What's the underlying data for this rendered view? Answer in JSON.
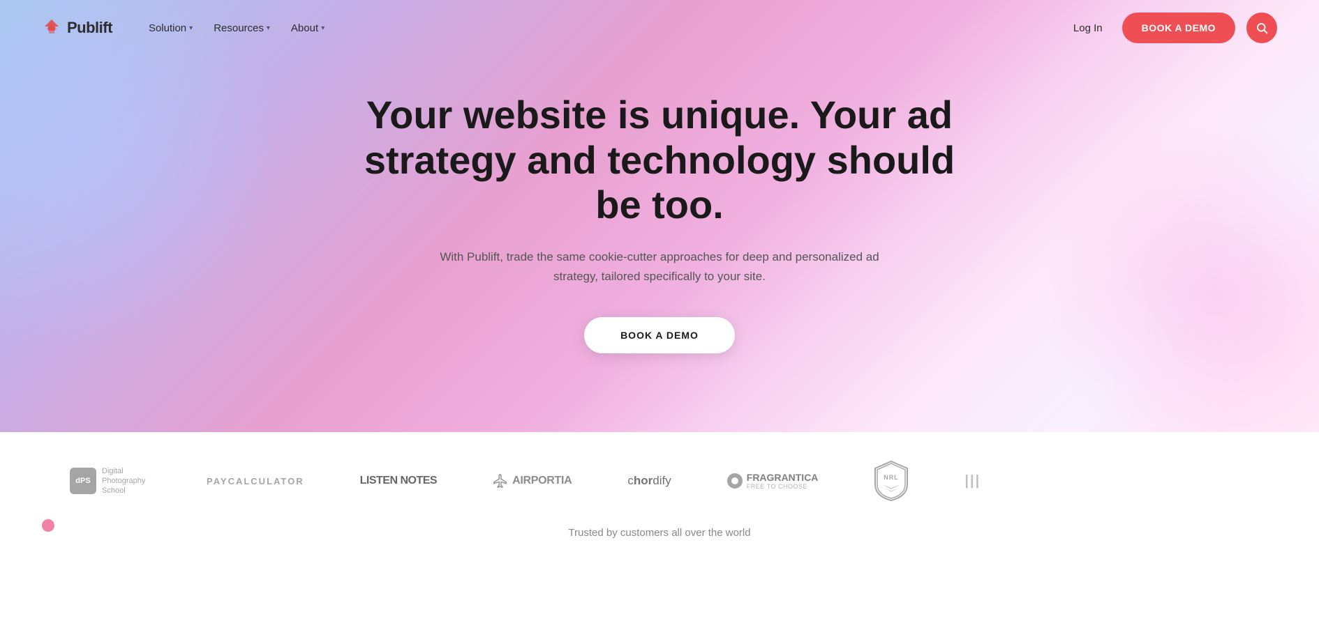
{
  "brand": {
    "name": "Publift",
    "logo_icon": "chevrons-up"
  },
  "nav": {
    "links": [
      {
        "label": "Solution",
        "has_dropdown": true
      },
      {
        "label": "Resources",
        "has_dropdown": true
      },
      {
        "label": "About",
        "has_dropdown": true
      }
    ],
    "login_label": "Log In",
    "book_demo_label": "BOOK A DEMO",
    "search_icon": "search"
  },
  "hero": {
    "title": "Your website is unique. Your ad strategy and technology should be too.",
    "subtitle": "With Publift, trade the same cookie-cutter approaches for deep and personalized ad strategy, tailored specifically to your site.",
    "cta_label": "BOOK A DEMO"
  },
  "logos": {
    "trusted_text": "Trusted by customers all over the world",
    "items": [
      {
        "id": "dps",
        "name": "Digital Photography School",
        "type": "dps"
      },
      {
        "id": "paycalculator",
        "name": "PAYCALCULATOR",
        "type": "text"
      },
      {
        "id": "listennotes",
        "name": "LISTEN NOTES",
        "type": "listen-notes"
      },
      {
        "id": "airportia",
        "name": "AIRPORTIA",
        "type": "airportia"
      },
      {
        "id": "chordify",
        "name": "chordify",
        "type": "chordify"
      },
      {
        "id": "fragrantica",
        "name": "FRAGRANTICA",
        "type": "fragrantica"
      },
      {
        "id": "nrl",
        "name": "NRL",
        "type": "nrl"
      },
      {
        "id": "unknown",
        "name": "|||",
        "type": "bars"
      }
    ]
  },
  "colors": {
    "primary": "#f04e55",
    "nav_text": "#2d2d2d",
    "hero_title": "#1a1a1a",
    "hero_subtitle": "#555555"
  }
}
